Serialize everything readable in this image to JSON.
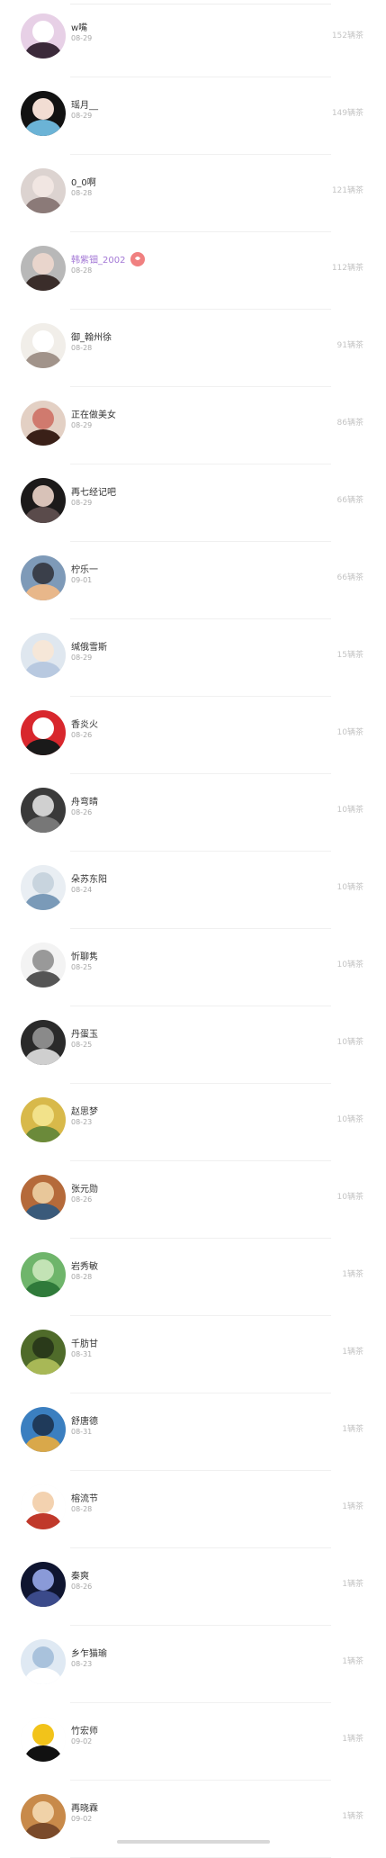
{
  "list": {
    "items": [
      {
        "name": "w嘴",
        "date": "08-29",
        "count": "152辆茶",
        "avatar_icon": "flower-avatar-icon",
        "colors": [
          "#e7d0e6",
          "#3b2a3a",
          "#ffffff"
        ]
      },
      {
        "name": "瑶月__",
        "date": "08-29",
        "count": "149辆茶",
        "avatar_icon": "girl-blue-hair-avatar-icon",
        "colors": [
          "#121212",
          "#6bb3d6",
          "#f2ddd3"
        ]
      },
      {
        "name": "0_0啊",
        "date": "08-28",
        "count": "121辆茶",
        "avatar_icon": "girl-selfie-avatar-icon",
        "colors": [
          "#dcd3d0",
          "#8b7a78",
          "#f1e6e2"
        ]
      },
      {
        "name": "韩紫钿_2002",
        "date": "08-28",
        "count": "112辆茶",
        "avatar_icon": "girl-portrait-avatar-icon",
        "colors": [
          "#b8b8b8",
          "#3a2d2a",
          "#e9d5cc"
        ],
        "vip": true,
        "badge_icon": "vip-badge-icon"
      },
      {
        "name": "御_翰州徐",
        "date": "08-28",
        "count": "91辆茶",
        "avatar_icon": "cat-hat-avatar-icon",
        "colors": [
          "#f1eee9",
          "#a1938a",
          "#ffffff"
        ]
      },
      {
        "name": "正在做美女",
        "date": "08-29",
        "count": "86辆茶",
        "avatar_icon": "girl-red-lips-avatar-icon",
        "colors": [
          "#e3d0c4",
          "#3a2018",
          "#d07a6e"
        ]
      },
      {
        "name": "再七经记吧",
        "date": "08-29",
        "count": "66辆茶",
        "avatar_icon": "dark-hair-avatar-icon",
        "colors": [
          "#1c1a1a",
          "#5a4b4b",
          "#d8c2b8"
        ]
      },
      {
        "name": "柠乐一",
        "date": "09-01",
        "count": "66辆茶",
        "avatar_icon": "sunset-avatar-icon",
        "colors": [
          "#7e9ab8",
          "#e8b78a",
          "#3a3f4a"
        ]
      },
      {
        "name": "缄俄雪斯",
        "date": "08-29",
        "count": "15辆茶",
        "avatar_icon": "anime-girl-avatar-icon",
        "colors": [
          "#dfe7ef",
          "#b8c9e0",
          "#f6e7d8"
        ]
      },
      {
        "name": "香炎火",
        "date": "08-26",
        "count": "10辆茶",
        "avatar_icon": "red-hat-avatar-icon",
        "colors": [
          "#d8272d",
          "#1a1a1a",
          "#ffffff"
        ]
      },
      {
        "name": "舟弯晴",
        "date": "08-26",
        "count": "10辆茶",
        "avatar_icon": "dark-text-avatar-icon",
        "colors": [
          "#3a3a3a",
          "#777777",
          "#d0d0d0"
        ]
      },
      {
        "name": "朵苏东阳",
        "date": "08-24",
        "count": "10辆茶",
        "avatar_icon": "blue-flowers-avatar-icon",
        "colors": [
          "#e9eef3",
          "#7a9ab8",
          "#c8d4de"
        ]
      },
      {
        "name": "忻聊隽",
        "date": "08-25",
        "count": "10辆茶",
        "avatar_icon": "heart-text-avatar-icon",
        "colors": [
          "#f3f3f3",
          "#555555",
          "#999999"
        ]
      },
      {
        "name": "丹蛋玉",
        "date": "08-25",
        "count": "10辆茶",
        "avatar_icon": "bw-portrait-avatar-icon",
        "colors": [
          "#2a2a2a",
          "#cfcfcf",
          "#8a8a8a"
        ]
      },
      {
        "name": "赵思梦",
        "date": "08-23",
        "count": "10辆茶",
        "avatar_icon": "yellow-flowers-avatar-icon",
        "colors": [
          "#d8b94a",
          "#6b8a3a",
          "#f2e28a"
        ]
      },
      {
        "name": "张元勋",
        "date": "08-26",
        "count": "10辆茶",
        "avatar_icon": "food-avatar-icon",
        "colors": [
          "#b56a3a",
          "#3a5a7a",
          "#e8c79a"
        ]
      },
      {
        "name": "岩秀敏",
        "date": "08-28",
        "count": "1辆茶",
        "avatar_icon": "green-leaf-avatar-icon",
        "colors": [
          "#6fb56b",
          "#2f7a3a",
          "#c3e3b5"
        ]
      },
      {
        "name": "千肪甘",
        "date": "08-31",
        "count": "1辆茶",
        "avatar_icon": "green-field-avatar-icon",
        "colors": [
          "#4f6b2a",
          "#a8b856",
          "#2a3a1a"
        ]
      },
      {
        "name": "舒唐德",
        "date": "08-31",
        "count": "1辆茶",
        "avatar_icon": "landscape-avatar-icon",
        "colors": [
          "#3b7fc0",
          "#d9a84a",
          "#1f3a5a"
        ]
      },
      {
        "name": "榕流节",
        "date": "08-28",
        "count": "1辆茶",
        "avatar_icon": "cartoon-old-man-avatar-icon",
        "colors": [
          "#ffffff",
          "#c0392b",
          "#f3d2b0"
        ]
      },
      {
        "name": "秦爽",
        "date": "08-26",
        "count": "1辆茶",
        "avatar_icon": "night-sky-avatar-icon",
        "colors": [
          "#0f1530",
          "#3b4a8a",
          "#8a9ad8"
        ]
      },
      {
        "name": "乡乍猫瑜",
        "date": "08-23",
        "count": "1辆茶",
        "avatar_icon": "star-avatar-icon",
        "colors": [
          "#dfe9f3",
          "#ffffff",
          "#a9c2dc"
        ]
      },
      {
        "name": "竹宏师",
        "date": "09-02",
        "count": "1辆茶",
        "avatar_icon": "penguin-avatar-icon",
        "colors": [
          "#ffffff",
          "#111111",
          "#f2c31a"
        ]
      },
      {
        "name": "再晓霖",
        "date": "09-02",
        "count": "1辆茶",
        "avatar_icon": "bread-avatar-icon",
        "colors": [
          "#c88a4a",
          "#7a4a2a",
          "#f0d2a8"
        ]
      }
    ]
  }
}
